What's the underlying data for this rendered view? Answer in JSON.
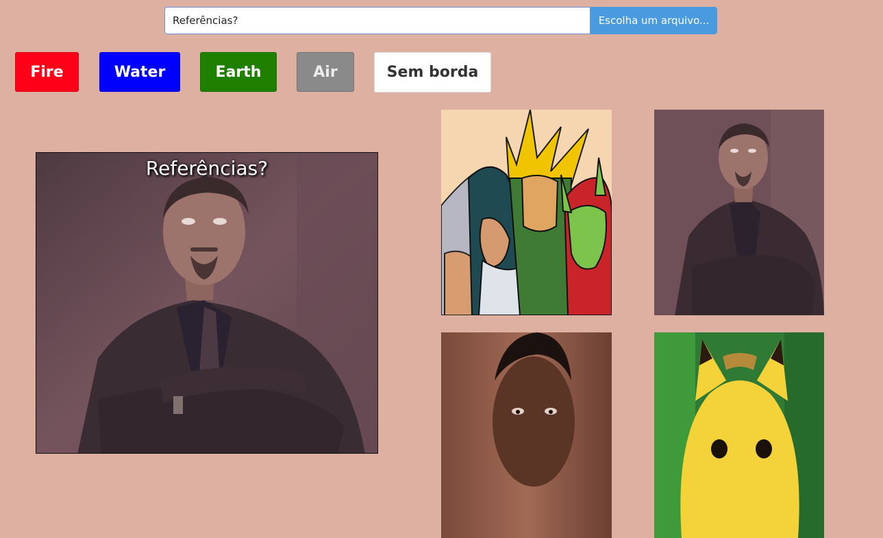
{
  "meme_editor": {
    "caption_input_value": "Referências?",
    "file_button_label": "Escolha um arquivo...",
    "themes": {
      "fire": "Fire",
      "water": "Water",
      "earth": "Earth",
      "air": "Air",
      "no_border": "Sem borda"
    },
    "preview_caption": "Referências?"
  },
  "colors": {
    "background": "#ddb0a2",
    "fire": "#ff0019",
    "water": "#0000ff",
    "earth": "#1f8000",
    "air": "#8a8a8a",
    "file_button": "#4a9ae0"
  },
  "gallery": [
    {
      "subject": "robert-downey-eye-roll"
    },
    {
      "subject": "me-gusta-cartoon-villains"
    },
    {
      "subject": "robert-downey-eye-roll"
    },
    {
      "subject": "sad-will-smith"
    },
    {
      "subject": "surprised-pikachu"
    }
  ]
}
